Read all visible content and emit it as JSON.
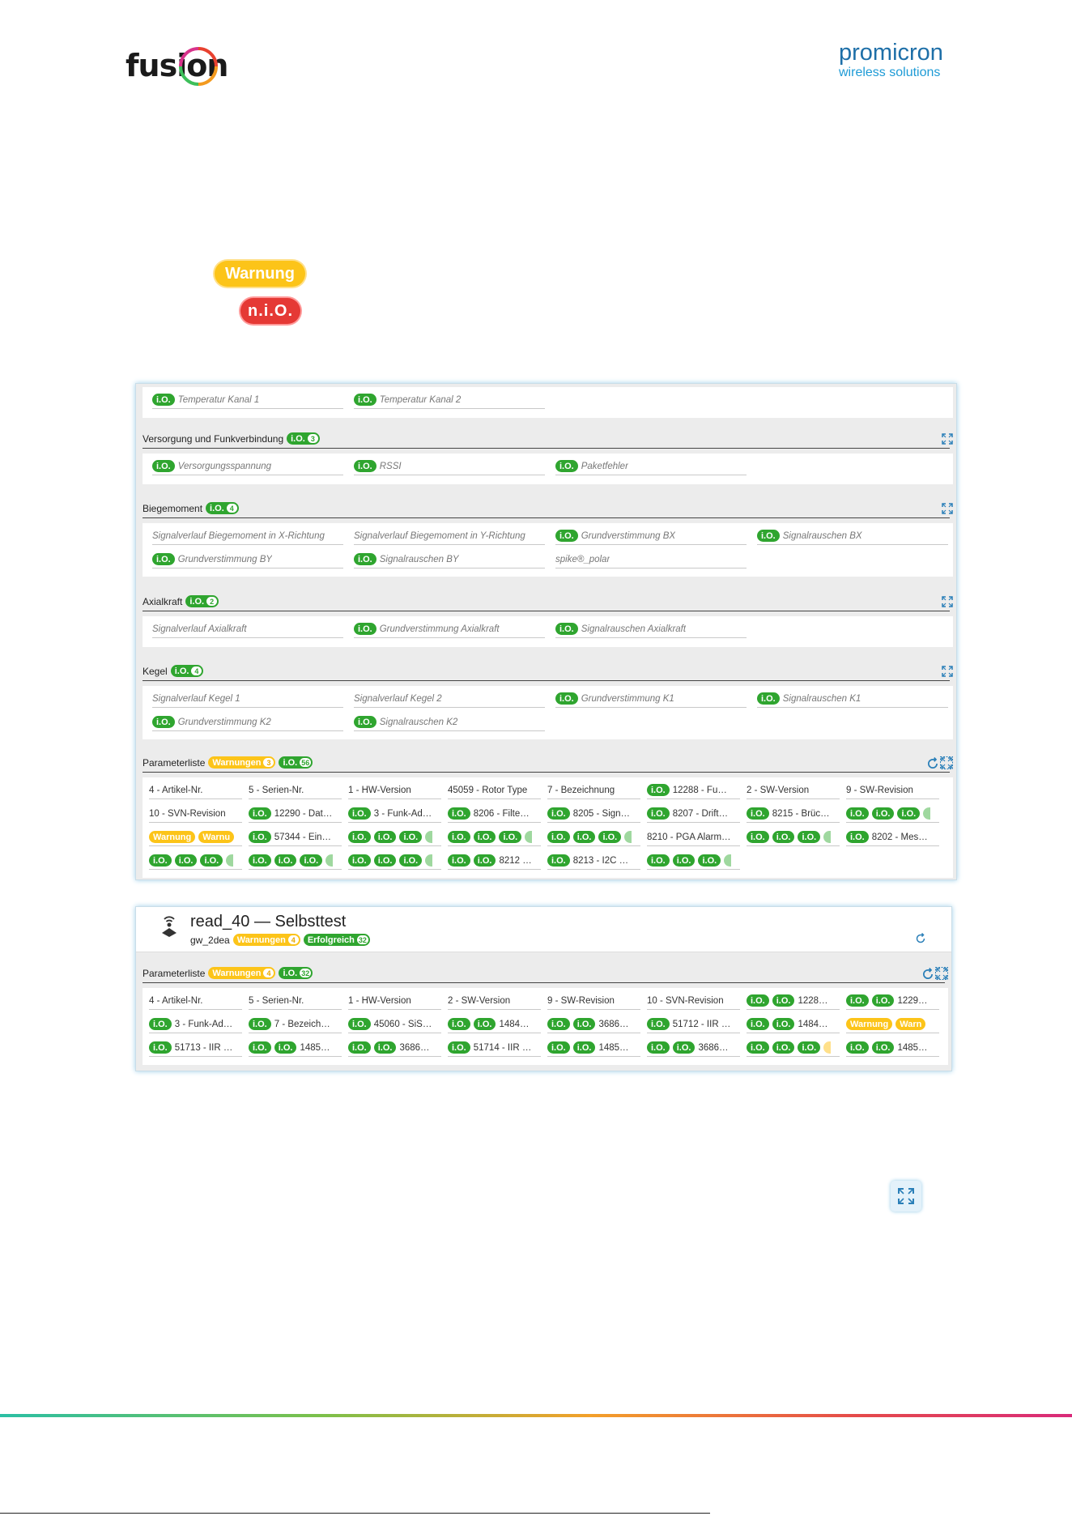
{
  "logos": {
    "left_text": "fusion",
    "right_line1": "promicron",
    "right_line2": "wireless solutions"
  },
  "legend": {
    "warning_label": "Warnung",
    "nio_label": "n.i.O."
  },
  "panel1": {
    "top_row": [
      {
        "badge": "i.O.",
        "label": "Temperatur Kanal 1"
      },
      {
        "badge": "i.O.",
        "label": "Temperatur Kanal 2"
      }
    ],
    "sections": [
      {
        "title": "Versorgung und Funkverbindung",
        "io_label": "i.O.",
        "io_count": "3",
        "rows": [
          [
            {
              "badge": "i.O.",
              "label": "Versorgungsspannung"
            },
            {
              "badge": "i.O.",
              "label": "RSSI"
            },
            {
              "badge": "i.O.",
              "label": "Paketfehler"
            }
          ]
        ]
      },
      {
        "title": "Biegemoment",
        "io_label": "i.O.",
        "io_count": "4",
        "rows": [
          [
            {
              "badge": "",
              "label": "Signalverlauf Biegemoment in X-Richtung"
            },
            {
              "badge": "",
              "label": "Signalverlauf Biegemoment in Y-Richtung"
            },
            {
              "badge": "i.O.",
              "label": "Grundverstimmung BX"
            },
            {
              "badge": "i.O.",
              "label": "Signalrauschen BX"
            }
          ],
          [
            {
              "badge": "i.O.",
              "label": "Grundverstimmung BY"
            },
            {
              "badge": "i.O.",
              "label": "Signalrauschen BY"
            },
            {
              "badge": "",
              "label": "spike®_polar"
            }
          ]
        ]
      },
      {
        "title": "Axialkraft",
        "io_label": "i.O.",
        "io_count": "2",
        "rows": [
          [
            {
              "badge": "",
              "label": "Signalverlauf Axialkraft"
            },
            {
              "badge": "i.O.",
              "label": "Grundverstimmung Axialkraft"
            },
            {
              "badge": "i.O.",
              "label": "Signalrauschen Axialkraft"
            }
          ]
        ]
      },
      {
        "title": "Kegel",
        "io_label": "i.O.",
        "io_count": "4",
        "rows": [
          [
            {
              "badge": "",
              "label": "Signalverlauf Kegel 1"
            },
            {
              "badge": "",
              "label": "Signalverlauf Kegel 2"
            },
            {
              "badge": "i.O.",
              "label": "Grundverstimmung K1"
            },
            {
              "badge": "i.O.",
              "label": "Signalrauschen K1"
            }
          ],
          [
            {
              "badge": "i.O.",
              "label": "Grundverstimmung K2"
            },
            {
              "badge": "i.O.",
              "label": "Signalrauschen K2"
            }
          ]
        ]
      }
    ],
    "params": {
      "title": "Parameterliste",
      "warn_label": "Warnungen",
      "warn_count": "3",
      "io_label": "i.O.",
      "io_count": "56",
      "rows": [
        [
          {
            "b": [],
            "label": "4 - Artikel-Nr."
          },
          {
            "b": [],
            "label": "5 - Serien-Nr."
          },
          {
            "b": [],
            "label": "1 - HW-Version"
          },
          {
            "b": [],
            "label": "45059 - Rotor Type"
          },
          {
            "b": [],
            "label": "7 - Bezeichnung"
          },
          {
            "b": [
              "i.O."
            ],
            "label": "12288 - Fu…"
          },
          {
            "b": [],
            "label": "2 - SW-Version"
          },
          {
            "b": [],
            "label": "9 - SW-Revision"
          }
        ],
        [
          {
            "b": [],
            "label": "10 - SVN-Revision"
          },
          {
            "b": [
              "i.O."
            ],
            "label": "12290 - Dat…"
          },
          {
            "b": [
              "i.O."
            ],
            "label": "3 - Funk-Ad…"
          },
          {
            "b": [
              "i.O."
            ],
            "label": "8206 - Filte…"
          },
          {
            "b": [
              "i.O."
            ],
            "label": "8205 - Sign…"
          },
          {
            "b": [
              "i.O."
            ],
            "label": "8207 - Drift…"
          },
          {
            "b": [
              "i.O."
            ],
            "label": "8215 - Brüc…"
          },
          {
            "b": [
              "i.O.",
              "i.O.",
              "i.O."
            ],
            "stub": "g",
            "label": ""
          }
        ],
        [
          {
            "b": [
              "Warnung",
              "Warnu"
            ],
            "label": ""
          },
          {
            "b": [
              "i.O."
            ],
            "label": "57344 - Ein…"
          },
          {
            "b": [
              "i.O.",
              "i.O.",
              "i.O."
            ],
            "stub": "g",
            "label": ""
          },
          {
            "b": [
              "i.O.",
              "i.O.",
              "i.O."
            ],
            "stub": "g",
            "label": ""
          },
          {
            "b": [
              "i.O.",
              "i.O.",
              "i.O."
            ],
            "stub": "g",
            "label": ""
          },
          {
            "b": [],
            "label": "8210 - PGA Alarm…"
          },
          {
            "b": [
              "i.O.",
              "i.O.",
              "i.O."
            ],
            "stub": "g",
            "label": ""
          },
          {
            "b": [
              "i.O."
            ],
            "label": "8202 - Mes…"
          }
        ],
        [
          {
            "b": [
              "i.O.",
              "i.O.",
              "i.O."
            ],
            "stub": "g",
            "label": ""
          },
          {
            "b": [
              "i.O.",
              "i.O.",
              "i.O."
            ],
            "stub": "g",
            "label": ""
          },
          {
            "b": [
              "i.O.",
              "i.O.",
              "i.O."
            ],
            "stub": "g",
            "label": ""
          },
          {
            "b": [
              "i.O.",
              "i.O."
            ],
            "label": "8212 …"
          },
          {
            "b": [
              "i.O."
            ],
            "label": "8213 - I2C …"
          },
          {
            "b": [
              "i.O.",
              "i.O.",
              "i.O."
            ],
            "stub": "g",
            "label": ""
          }
        ]
      ]
    }
  },
  "panel2": {
    "title": "read_40 — Selbsttest",
    "subtitle": "gw_2dea",
    "warn_label": "Warnungen",
    "warn_count": "4",
    "ok_label": "Erfolgreich",
    "ok_count": "32",
    "params": {
      "title": "Parameterliste",
      "warn_label": "Warnungen",
      "warn_count": "4",
      "io_label": "i.O.",
      "io_count": "32",
      "rows": [
        [
          {
            "b": [],
            "label": "4 - Artikel-Nr."
          },
          {
            "b": [],
            "label": "5 - Serien-Nr."
          },
          {
            "b": [],
            "label": "1 - HW-Version"
          },
          {
            "b": [],
            "label": "2 - SW-Version"
          },
          {
            "b": [],
            "label": "9 - SW-Revision"
          },
          {
            "b": [],
            "label": "10 - SVN-Revision"
          },
          {
            "b": [
              "i.O.",
              "i.O."
            ],
            "label": "1228…"
          },
          {
            "b": [
              "i.O.",
              "i.O."
            ],
            "label": "1229…"
          }
        ],
        [
          {
            "b": [
              "i.O."
            ],
            "label": "3 - Funk-Ad…"
          },
          {
            "b": [
              "i.O."
            ],
            "label": "7 - Bezeich…"
          },
          {
            "b": [
              "i.O."
            ],
            "label": "45060 - SiS…"
          },
          {
            "b": [
              "i.O.",
              "i.O."
            ],
            "label": "1484…"
          },
          {
            "b": [
              "i.O.",
              "i.O."
            ],
            "label": "3686…"
          },
          {
            "b": [
              "i.O."
            ],
            "label": "51712 - IIR …"
          },
          {
            "b": [
              "i.O.",
              "i.O."
            ],
            "label": "1484…"
          },
          {
            "b": [
              "Warnung",
              "Warn"
            ],
            "label": ""
          }
        ],
        [
          {
            "b": [
              "i.O."
            ],
            "label": "51713 - IIR …"
          },
          {
            "b": [
              "i.O.",
              "i.O."
            ],
            "label": "1485…"
          },
          {
            "b": [
              "i.O.",
              "i.O."
            ],
            "label": "3686…"
          },
          {
            "b": [
              "i.O."
            ],
            "label": "51714 - IIR …"
          },
          {
            "b": [
              "i.O.",
              "i.O."
            ],
            "label": "1485…"
          },
          {
            "b": [
              "i.O.",
              "i.O."
            ],
            "label": "3686…"
          },
          {
            "b": [
              "i.O.",
              "i.O.",
              "i.O."
            ],
            "stub": "w",
            "label": ""
          },
          {
            "b": [
              "i.O.",
              "i.O."
            ],
            "label": "1485…"
          }
        ]
      ]
    }
  }
}
